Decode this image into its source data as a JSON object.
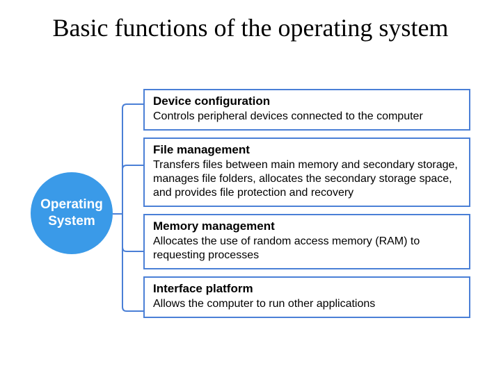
{
  "title": "Basic functions of the operating system",
  "center": {
    "line1": "Operating",
    "line2": "System"
  },
  "boxes": [
    {
      "title": "Device configuration",
      "desc": "Controls peripheral devices connected to the computer"
    },
    {
      "title": "File management",
      "desc": "Transfers files between main memory and secondary storage, manages file folders, allocates the secondary storage space, and provides file protection and recovery"
    },
    {
      "title": "Memory management",
      "desc": "Allocates the use of random access memory (RAM) to requesting processes"
    },
    {
      "title": "Interface platform",
      "desc": "Allows the computer to run other applications"
    }
  ],
  "colors": {
    "circle": "#3a9ae8",
    "boxBorder": "#4a7fd6",
    "connector": "#4a7fd6"
  }
}
